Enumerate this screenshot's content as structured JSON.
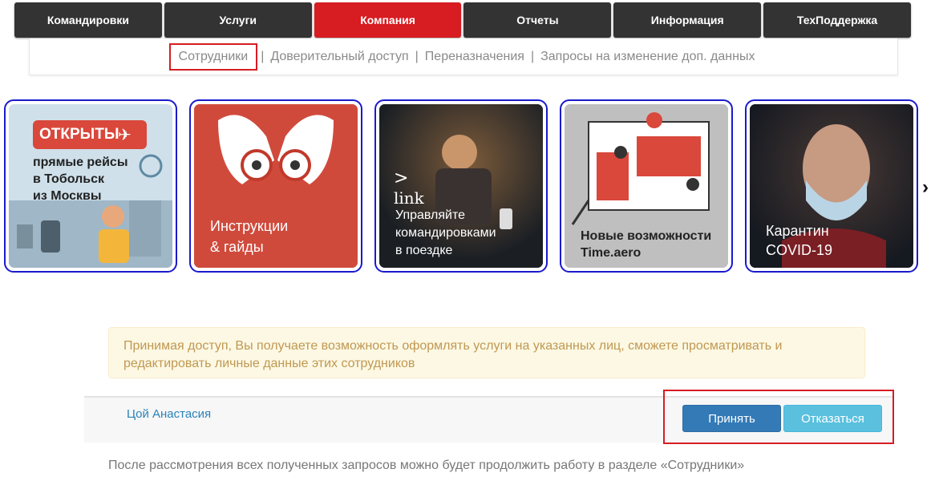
{
  "nav": {
    "tabs": [
      {
        "label": "Командировки"
      },
      {
        "label": "Услуги"
      },
      {
        "label": "Компания",
        "active": true
      },
      {
        "label": "Отчеты"
      },
      {
        "label": "Информация"
      },
      {
        "label": "ТехПоддержка"
      }
    ],
    "active_color": "#d71c22"
  },
  "subnav": {
    "items": [
      "Сотрудники",
      "Доверительный доступ",
      "Переназначения",
      "Запросы на изменение доп. данных"
    ],
    "separator": "|",
    "current": "Сотрудники"
  },
  "banners": [
    {
      "badge": "ОТКРЫТЫ",
      "lines": [
        "прямые рейсы",
        "в Тобольск",
        "из Москвы"
      ]
    },
    {
      "lines": [
        "Инструкции",
        "& гайды"
      ]
    },
    {
      "logo": "link",
      "lines": [
        "Управляйте",
        "командировками",
        "в поездке"
      ]
    },
    {
      "lines": [
        "Новые возможности",
        "Time.aero"
      ]
    },
    {
      "lines": [
        "Карантин",
        "COVID-19"
      ]
    }
  ],
  "carousel": {
    "next_icon": "chevron-right-icon"
  },
  "notice": {
    "text": "Принимая доступ, Вы получаете возможность оформлять услуги на указанных лиц, сможете просматривать и редактировать личные данные этих сотрудников"
  },
  "request": {
    "name": "Цой Анастасия",
    "accept_label": "Принять",
    "reject_label": "Отказаться"
  },
  "footer_note": "После рассмотрения всех полученных запросов можно будет продолжить работу в разделе «Сотрудники»"
}
